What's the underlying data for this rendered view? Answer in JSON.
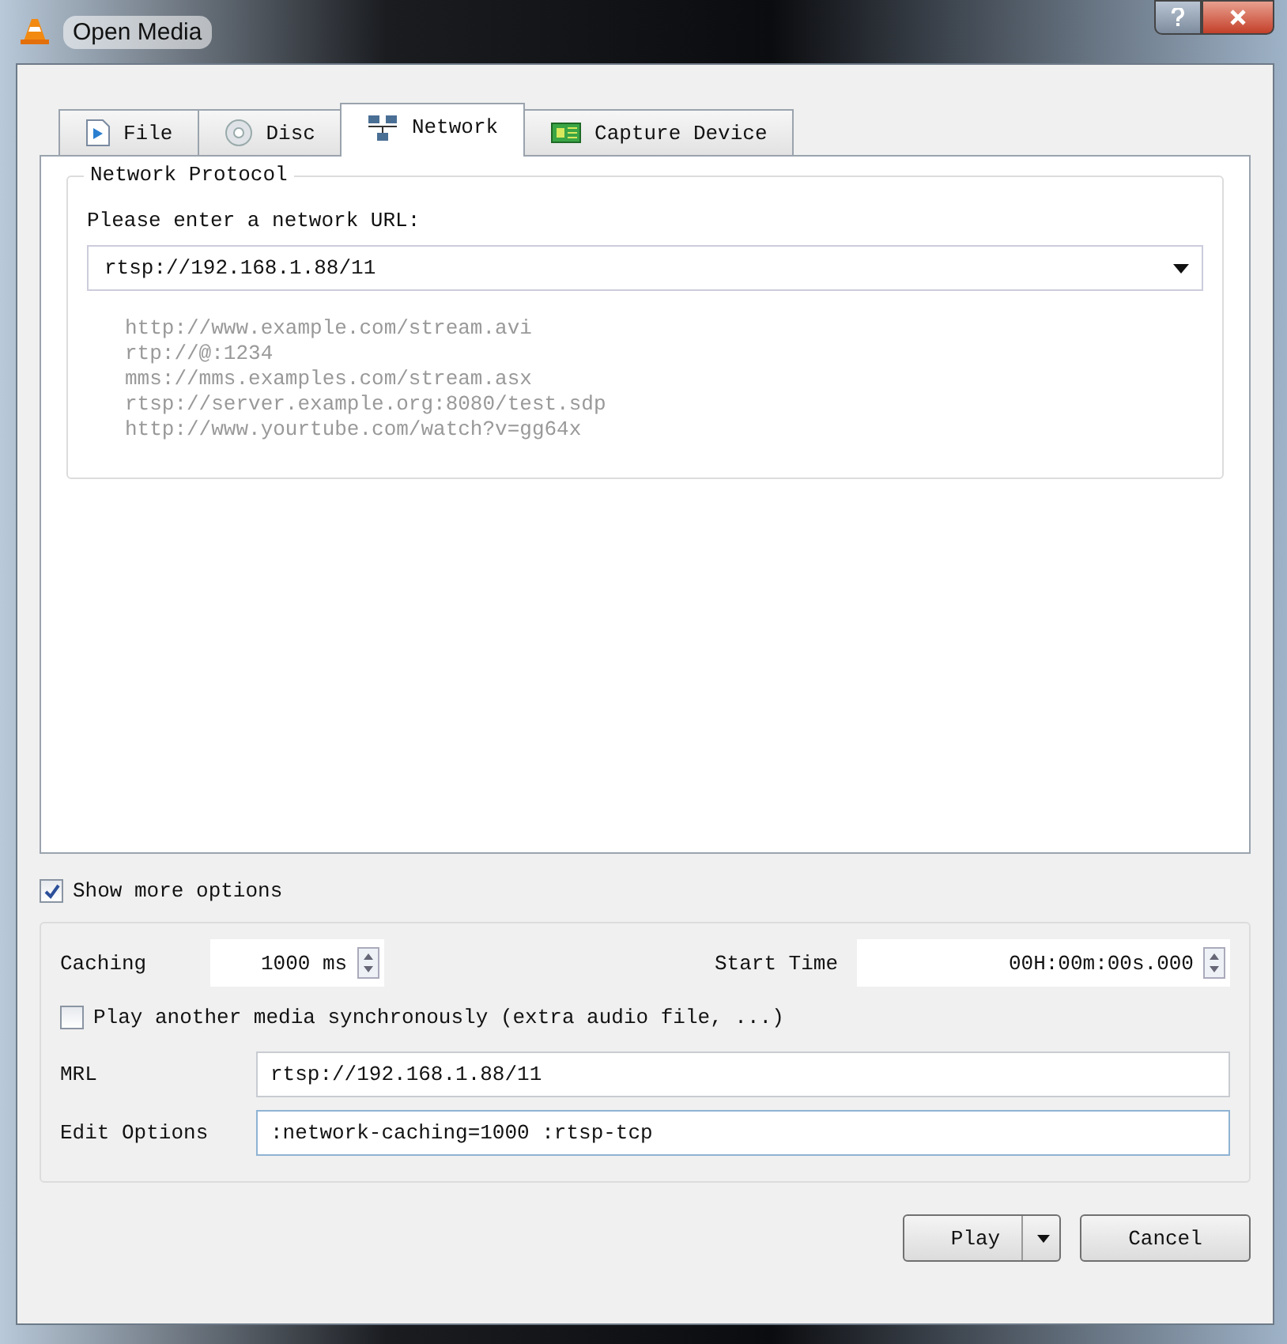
{
  "window": {
    "title": "Open Media"
  },
  "tabs": [
    {
      "label": "File",
      "kind": "file",
      "selected": false
    },
    {
      "label": "Disc",
      "kind": "disc",
      "selected": false
    },
    {
      "label": "Network",
      "kind": "network",
      "selected": true
    },
    {
      "label": "Capture Device",
      "kind": "capture",
      "selected": false
    }
  ],
  "network_protocol": {
    "title": "Network Protocol",
    "prompt": "Please enter a network URL:",
    "url": "rtsp://192.168.1.88/11",
    "examples": [
      "http://www.example.com/stream.avi",
      "rtp://@:1234",
      "mms://mms.examples.com/stream.asx",
      "rtsp://server.example.org:8080/test.sdp",
      "http://www.yourtube.com/watch?v=gg64x"
    ]
  },
  "show_more_options": {
    "label": "Show more options",
    "checked": true
  },
  "options": {
    "caching_label": "Caching",
    "caching": "1000 ms",
    "start_time_label": "Start Time",
    "start_time": "00H:00m:00s.000",
    "sync": {
      "label": "Play another media synchronously (extra audio file, ...)",
      "checked": false
    },
    "mrl_label": "MRL",
    "mrl": "rtsp://192.168.1.88/11",
    "edit_options_label": "Edit Options",
    "edit_options": " :network-caching=1000 :rtsp-tcp"
  },
  "buttons": [
    {
      "label": "Play",
      "kind": "split"
    },
    {
      "label": "Cancel",
      "kind": "plain"
    }
  ]
}
